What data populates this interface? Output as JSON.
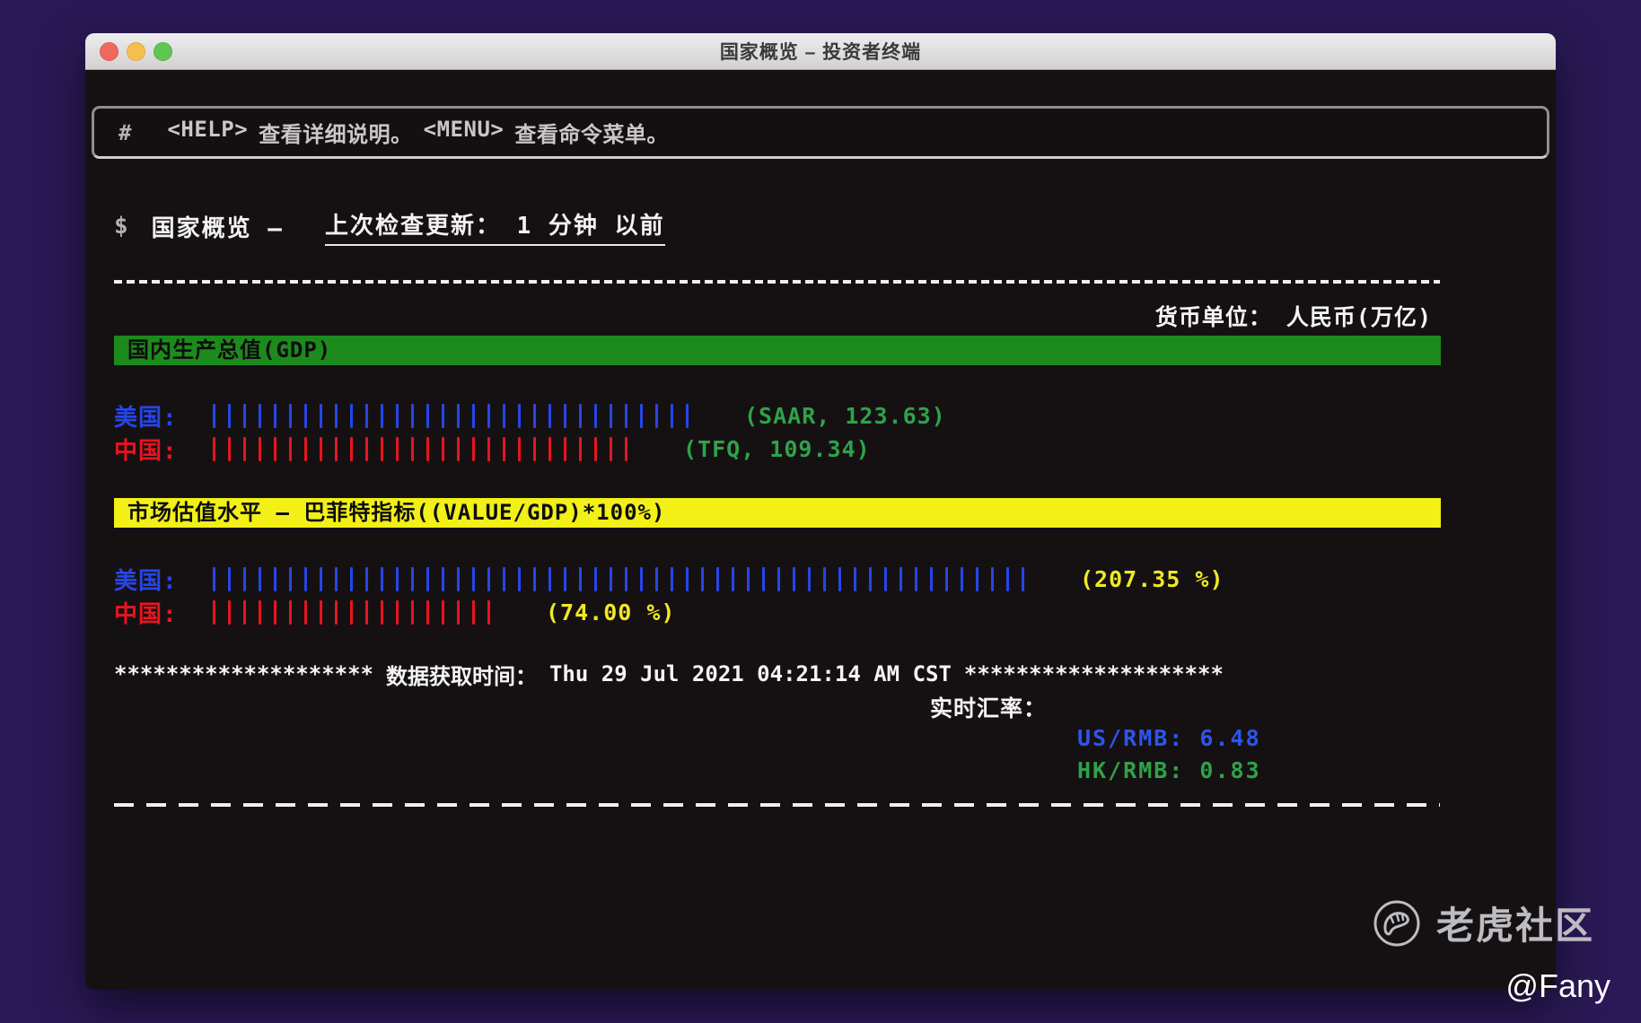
{
  "window": {
    "title": "国家概览 – 投资者终端"
  },
  "titlebar_buttons": {
    "close": "close",
    "minimize": "minimize",
    "zoom": "zoom"
  },
  "help_bar": {
    "prompt": "#",
    "help_token": "<HELP>",
    "help_desc": "查看详细说明。",
    "menu_token": "<MENU>",
    "menu_desc": "查看命令菜单。"
  },
  "command_line": {
    "prompt": "$",
    "app": "国家概览 –",
    "status": "上次检查更新： 1 分钟 以前"
  },
  "currency_note": "货币单位： 人民币(万亿)",
  "gdp_section": {
    "header": "国内生产总值(GDP)",
    "rows": [
      {
        "label": "美国:",
        "color": "blue",
        "bars": 32,
        "value": 123.63,
        "value_text": "(SAAR, 123.63)",
        "value_color": "green"
      },
      {
        "label": "中国:",
        "color": "red",
        "bars": 28,
        "value": 109.34,
        "value_text": "(TFQ, 109.34)",
        "value_color": "green"
      }
    ]
  },
  "buffett_section": {
    "header": "市场估值水平 – 巴菲特指标((VALUE/GDP)*100%)",
    "rows": [
      {
        "label": "美国:",
        "color": "blue",
        "bars": 54,
        "value": 207.35,
        "value_text": "(207.35 %)",
        "value_color": "yellow"
      },
      {
        "label": "中国:",
        "color": "red",
        "bars": 19,
        "value": 74.0,
        "value_text": "(74.00 %)",
        "value_color": "yellow"
      }
    ]
  },
  "footer": {
    "stars_left": "********************",
    "fetch_label": "数据获取时间：",
    "timestamp": "Thu 29 Jul 2021 04:21:14 AM CST",
    "stars_right": "********************",
    "fx_title": "实时汇率：",
    "rates": [
      {
        "label": "US/RMB:",
        "value": "6.48",
        "color": "blue_rate"
      },
      {
        "label": "HK/RMB:",
        "value": "0.83",
        "color": "green"
      }
    ]
  },
  "watermark": {
    "community": "老虎社区",
    "author": "@Fany"
  },
  "colors": {
    "blue": "#2645e8",
    "red": "#e8141f",
    "green": "#2fa24a",
    "yellow": "#f0e827",
    "blue_rate": "#2c55ec",
    "gdp_header_bg": "#1d8a1d",
    "buffett_header_bg": "#f2f017",
    "window_bg": "#151112",
    "desktop_bg": "#2a1956"
  },
  "chart_data": [
    {
      "type": "bar",
      "title": "国内生产总值(GDP)",
      "unit": "人民币(万亿)",
      "categories": [
        "美国",
        "中国"
      ],
      "values": [
        123.63,
        109.34
      ],
      "annotations": [
        "SAAR, 123.63",
        "TFQ, 109.34"
      ],
      "bar_chars": [
        32,
        28
      ],
      "orientation": "horizontal"
    },
    {
      "type": "bar",
      "title": "市场估值水平 – 巴菲特指标((VALUE/GDP)*100%)",
      "unit": "%",
      "categories": [
        "美国",
        "中国"
      ],
      "values": [
        207.35,
        74.0
      ],
      "annotations": [
        "207.35 %",
        "74.00 %"
      ],
      "bar_chars": [
        54,
        19
      ],
      "orientation": "horizontal"
    }
  ]
}
